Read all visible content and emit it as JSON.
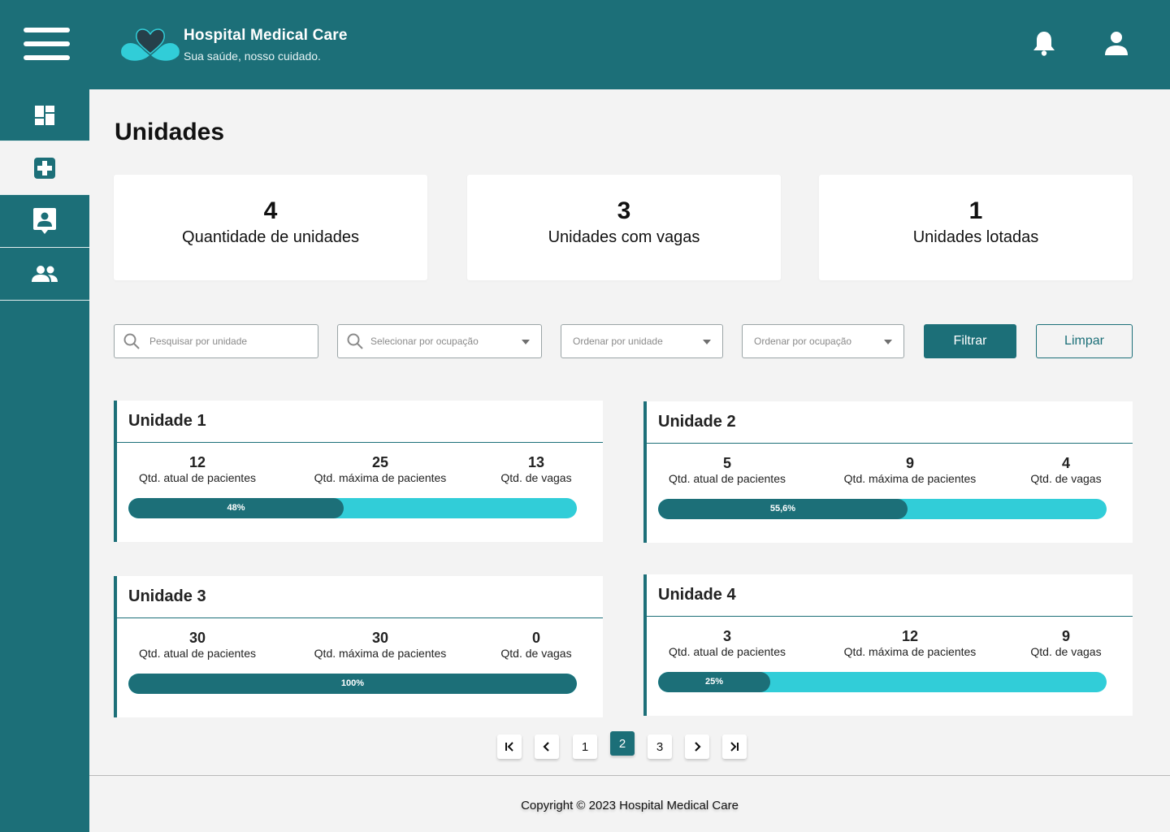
{
  "header": {
    "brand_title": "Hospital Medical Care",
    "brand_subtitle": "Sua saúde, nosso cuidado.",
    "icons": [
      "menu-icon",
      "heart-logo-icon",
      "bell-icon",
      "user-icon"
    ]
  },
  "sidebar": {
    "items": [
      {
        "icon": "dashboard-icon",
        "active": false
      },
      {
        "icon": "medical-plus-icon",
        "active": true
      },
      {
        "icon": "patient-badge-icon",
        "active": false
      },
      {
        "icon": "people-icon",
        "active": false
      }
    ]
  },
  "page": {
    "title": "Unidades"
  },
  "stats": [
    {
      "value": "4",
      "label": "Quantidade de unidades"
    },
    {
      "value": "3",
      "label": "Unidades com vagas"
    },
    {
      "value": "1",
      "label": "Unidades lotadas"
    }
  ],
  "filters": {
    "search_placeholder": "Pesquisar por unidade",
    "occupancy_placeholder": "Selecionar por ocupação",
    "order_unit_placeholder": "Ordenar por unidade",
    "order_occupancy_placeholder": "Ordenar por ocupação",
    "filter_button": "Filtrar",
    "clear_button": "Limpar"
  },
  "units": [
    {
      "name": "Unidade 1",
      "current": "12",
      "current_label": "Qtd. atual de pacientes",
      "max": "25",
      "max_label": "Qtd. máxima de pacientes",
      "vacancies": "13",
      "vacancies_label": "Qtd. de vagas",
      "occupancy": 0.48,
      "occupancy_label": "48%"
    },
    {
      "name": "Unidade 2",
      "current": "5",
      "current_label": "Qtd. atual de pacientes",
      "max": "9",
      "max_label": "Qtd. máxima de pacientes",
      "vacancies": "4",
      "vacancies_label": "Qtd. de vagas",
      "occupancy": 0.556,
      "occupancy_label": "55,6%"
    },
    {
      "name": "Unidade 3",
      "current": "30",
      "current_label": "Qtd. atual de pacientes",
      "max": "30",
      "max_label": "Qtd. máxima de pacientes",
      "vacancies": "0",
      "vacancies_label": "Qtd. de vagas",
      "occupancy": 1.0,
      "occupancy_label": "100%"
    },
    {
      "name": "Unidade 4",
      "current": "3",
      "current_label": "Qtd. atual de pacientes",
      "max": "12",
      "max_label": "Qtd. máxima de pacientes",
      "vacancies": "9",
      "vacancies_label": "Qtd. de vagas",
      "occupancy": 0.25,
      "occupancy_label": "25%"
    }
  ],
  "pagination": {
    "pages": [
      "1",
      "2",
      "3"
    ],
    "current": "2",
    "icons": [
      "first-page-icon",
      "prev-page-icon",
      "next-page-icon",
      "last-page-icon"
    ]
  },
  "footer": {
    "text": "Copyright © 2023 Hospital Medical Care"
  },
  "colors": {
    "primary": "#1c6f78",
    "accent": "#31cdd8",
    "background": "#f3f3f3"
  }
}
